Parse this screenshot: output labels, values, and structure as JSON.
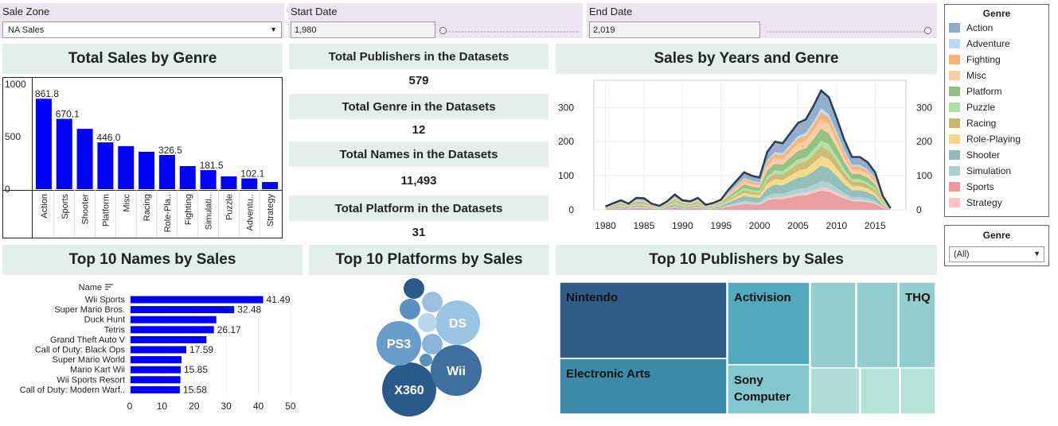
{
  "filters": {
    "sale_zone": {
      "label": "Sale Zone",
      "value": "NA Sales"
    },
    "start_date": {
      "label": "Start Date",
      "value": "1,980"
    },
    "end_date": {
      "label": "End Date",
      "value": "2,019"
    }
  },
  "total_sales_by_genre": {
    "title": "Total Sales by Genre",
    "chart_data": {
      "type": "bar",
      "categories": [
        "Action",
        "Sports",
        "Shooter",
        "Platform",
        "Misc",
        "Racing",
        "Role-Pla..",
        "Fighting",
        "Simulati..",
        "Puzzle",
        "Adventu..",
        "Strategy"
      ],
      "values": [
        861.8,
        670.1,
        575,
        446.0,
        410,
        357,
        326.5,
        220,
        181.5,
        122,
        102.1,
        68
      ],
      "data_labels": [
        "861.8",
        "670.1",
        "",
        "446.0",
        "",
        "",
        "326.5",
        "",
        "181.5",
        "",
        "102.1",
        ""
      ],
      "ylim": [
        0,
        1000
      ],
      "yticks": [
        "1000",
        "500",
        "0"
      ],
      "color": "#0000ff"
    }
  },
  "kpis": [
    {
      "label": "Total Publishers in the Datasets",
      "value": "579"
    },
    {
      "label": "Total Genre in the Datasets",
      "value": "12"
    },
    {
      "label": "Total Names in the Datasets",
      "value": "11,493"
    },
    {
      "label": "Total Platform  in the Datasets",
      "value": "31"
    }
  ],
  "sales_by_years": {
    "title": "Sales by Years and Genre",
    "chart_data": {
      "type": "area",
      "x": [
        1980,
        1982,
        1983,
        1984,
        1985,
        1986,
        1987,
        1988,
        1989,
        1990,
        1991,
        1992,
        1993,
        1994,
        1995,
        1996,
        1997,
        1998,
        1999,
        2000,
        2001,
        2002,
        2003,
        2004,
        2005,
        2006,
        2007,
        2008,
        2009,
        2010,
        2011,
        2012,
        2013,
        2014,
        2015,
        2016,
        2017
      ],
      "totals": [
        10,
        28,
        18,
        35,
        34,
        18,
        12,
        25,
        45,
        28,
        25,
        35,
        15,
        20,
        30,
        60,
        85,
        110,
        100,
        95,
        170,
        200,
        195,
        225,
        255,
        265,
        305,
        350,
        330,
        270,
        205,
        155,
        155,
        140,
        110,
        40,
        5
      ],
      "series": [
        {
          "name": "Sports",
          "color": "#e99a9b",
          "fraction": 0.16
        },
        {
          "name": "Strategy",
          "color": "#f6c6c8",
          "fraction": 0.03
        },
        {
          "name": "Simulation",
          "color": "#aad2d0",
          "fraction": 0.05
        },
        {
          "name": "Shooter",
          "color": "#8fbcb8",
          "fraction": 0.13
        },
        {
          "name": "Role-Playing",
          "color": "#f2d98a",
          "fraction": 0.08
        },
        {
          "name": "Racing",
          "color": "#c9b76a",
          "fraction": 0.08
        },
        {
          "name": "Puzzle",
          "color": "#b2dea0",
          "fraction": 0.05
        },
        {
          "name": "Platform",
          "color": "#8cc07c",
          "fraction": 0.1
        },
        {
          "name": "Misc",
          "color": "#fccca3",
          "fraction": 0.08
        },
        {
          "name": "Fighting",
          "color": "#f7b26e",
          "fraction": 0.06
        },
        {
          "name": "Adventure",
          "color": "#c0d8ee",
          "fraction": 0.03
        },
        {
          "name": "Action",
          "color": "#8eaacb",
          "fraction": 0.15
        }
      ],
      "xticks": [
        "1980",
        "1985",
        "1990",
        "1995",
        "2000",
        "2005",
        "2010",
        "2015"
      ],
      "yticks": [
        "0",
        "100",
        "200",
        "300"
      ],
      "ylim": [
        0,
        380
      ]
    }
  },
  "legend": {
    "title": "Genre",
    "items": [
      {
        "label": "Action",
        "color": "#8eaacb"
      },
      {
        "label": "Adventure",
        "color": "#c0d8ee"
      },
      {
        "label": "Fighting",
        "color": "#f7b26e"
      },
      {
        "label": "Misc",
        "color": "#fccca3"
      },
      {
        "label": "Platform",
        "color": "#8cc07c"
      },
      {
        "label": "Puzzle",
        "color": "#b2dea0"
      },
      {
        "label": "Racing",
        "color": "#c9b76a"
      },
      {
        "label": "Role-Playing",
        "color": "#f2d98a"
      },
      {
        "label": "Shooter",
        "color": "#8fbcb8"
      },
      {
        "label": "Simulation",
        "color": "#aad2d0"
      },
      {
        "label": "Sports",
        "color": "#e99a9b"
      },
      {
        "label": "Strategy",
        "color": "#f6c6c8"
      }
    ]
  },
  "genre_filter": {
    "label": "Genre",
    "value": "(All)"
  },
  "top_names": {
    "title": "Top 10 Names by Sales",
    "header": "Name",
    "chart_data": {
      "type": "bar",
      "categories": [
        "Wii Sports",
        "Super Mario Bros.",
        "Duck Hunt",
        "Tetris",
        "Grand Theft Auto V",
        "Call of Duty: Black Ops",
        "Super Mario World",
        "Mario Kart Wii",
        "Wii Sports Resort",
        "Call of Duty: Modern Warf.."
      ],
      "values": [
        41.49,
        32.48,
        26.93,
        26.17,
        23.84,
        17.59,
        16.1,
        15.85,
        15.75,
        15.58
      ],
      "data_labels": [
        "41.49",
        "32.48",
        "",
        "26.17",
        "",
        "17.59",
        "",
        "15.85",
        "",
        "15.58"
      ],
      "xticks": [
        "0",
        "10",
        "20",
        "30",
        "40",
        "50"
      ],
      "xlim": [
        0,
        50
      ]
    }
  },
  "top_platforms": {
    "title": "Top 10 Platforms by Sales",
    "bubbles": [
      {
        "label": "X360",
        "value": 595,
        "color": "#2b5a8a"
      },
      {
        "label": "PS3",
        "value": 390,
        "color": "#6a9ccb"
      },
      {
        "label": "Wii",
        "value": 490,
        "color": "#3e6f9f"
      },
      {
        "label": "DS",
        "value": 390,
        "color": "#9bc4e4"
      },
      {
        "label": "",
        "value": 130,
        "color": "#9dc0df"
      },
      {
        "label": "",
        "value": 110,
        "color": "#b8d6ee"
      },
      {
        "label": "",
        "value": 110,
        "color": "#5d8fbe"
      },
      {
        "label": "",
        "value": 120,
        "color": "#2b5a8a"
      },
      {
        "label": "",
        "value": 100,
        "color": "#8ab4d8"
      },
      {
        "label": "",
        "value": 40,
        "color": "#5d8fbe"
      }
    ]
  },
  "top_publishers": {
    "title": "Top 10 Publishers by Sales",
    "tiles": [
      {
        "label": "Nintendo",
        "value": 816,
        "color": "#2f5d87"
      },
      {
        "label": "Electronic Arts",
        "value": 595,
        "color": "#3a8aa8"
      },
      {
        "label": "Activision",
        "value": 430,
        "color": "#52a8bd"
      },
      {
        "label": "Sony Computer",
        "value": 266,
        "color": "#84c6cd"
      },
      {
        "label": "",
        "value": 250,
        "color": "#93cdd0"
      },
      {
        "label": "",
        "value": 170,
        "color": "#93cdd0"
      },
      {
        "label": "THQ",
        "value": 210,
        "color": "#93cdd0"
      },
      {
        "label": "",
        "value": 125,
        "color": "#afddd6"
      },
      {
        "label": "",
        "value": 115,
        "color": "#b5e2d7"
      },
      {
        "label": "",
        "value": 105,
        "color": "#b5e2d7"
      }
    ]
  }
}
